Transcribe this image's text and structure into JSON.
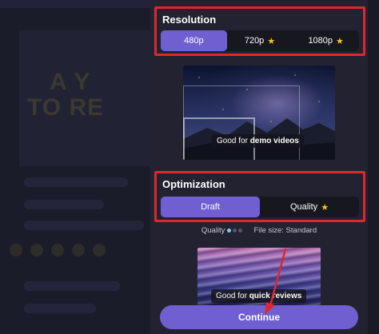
{
  "resolution": {
    "title": "Resolution",
    "options": [
      {
        "label": "480p",
        "premium": false,
        "selected": true
      },
      {
        "label": "720p",
        "premium": true,
        "selected": false
      },
      {
        "label": "1080p",
        "premium": true,
        "selected": false
      }
    ],
    "preview_caption_prefix": "Good for ",
    "preview_caption_bold": "demo videos"
  },
  "optimization": {
    "title": "Optimization",
    "options": [
      {
        "label": "Draft",
        "premium": false,
        "selected": true
      },
      {
        "label": "Quality",
        "premium": true,
        "selected": false
      }
    ],
    "quality_label": "Quality",
    "quality_level": 1,
    "quality_max": 3,
    "file_size_text": "File size: Standard",
    "preview_caption_prefix": "Good for ",
    "preview_caption_bold": "quick reviews"
  },
  "continue_label": "Continue",
  "colors": {
    "accent": "#6f5fd1",
    "highlight": "#e0262f",
    "star": "#f3c623"
  },
  "icons": {
    "premium": "star-icon"
  }
}
